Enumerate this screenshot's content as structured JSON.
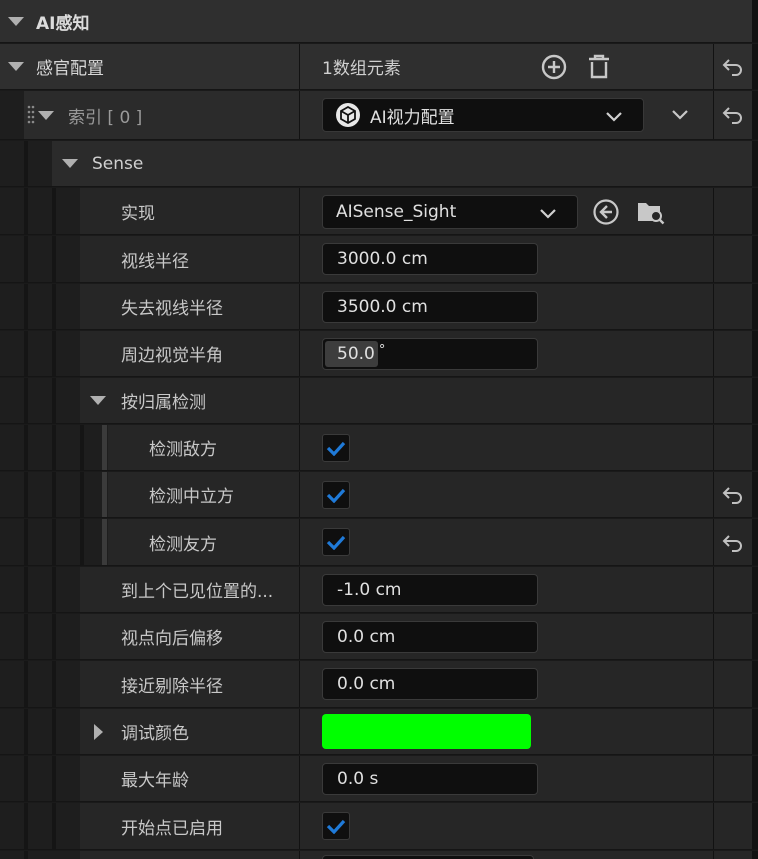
{
  "category": {
    "title": "AI感知"
  },
  "senses_config": {
    "label": "感官配置",
    "count_text": "1数组元素"
  },
  "index_row": {
    "label": "索引 [ 0 ]",
    "combo_value": "AI视力配置"
  },
  "sense_group": {
    "label": "Sense"
  },
  "implementation": {
    "label": "实现",
    "value": "AISense_Sight"
  },
  "sight_radius": {
    "label": "视线半径",
    "value": "3000.0 cm"
  },
  "lose_sight_radius": {
    "label": "失去视线半径",
    "value": "3500.0 cm"
  },
  "peripheral_angle": {
    "label": "周边视觉半角",
    "value": "50.0",
    "unit": "°"
  },
  "affiliation": {
    "label": "按归属检测",
    "items": [
      {
        "label": "检测敌方",
        "checked": true
      },
      {
        "label": "检测中立方",
        "checked": true
      },
      {
        "label": "检测友方",
        "checked": true
      }
    ]
  },
  "auto_success_range": {
    "label": "到上个已见位置的...",
    "value": "-1.0 cm"
  },
  "point_of_view_offset": {
    "label": "视点向后偏移",
    "value": "0.0 cm"
  },
  "near_clipping_radius": {
    "label": "接近剔除半径",
    "value": "0.0 cm"
  },
  "debug_color": {
    "label": "调试颜色",
    "color": "#00ff00"
  },
  "max_age": {
    "label": "最大年龄",
    "value": "0.0 s"
  },
  "starts_enabled": {
    "label": "开始点已启用",
    "checked": true
  },
  "colors": {
    "check": "#1f7ad8",
    "accent_green": "#00ff00"
  }
}
